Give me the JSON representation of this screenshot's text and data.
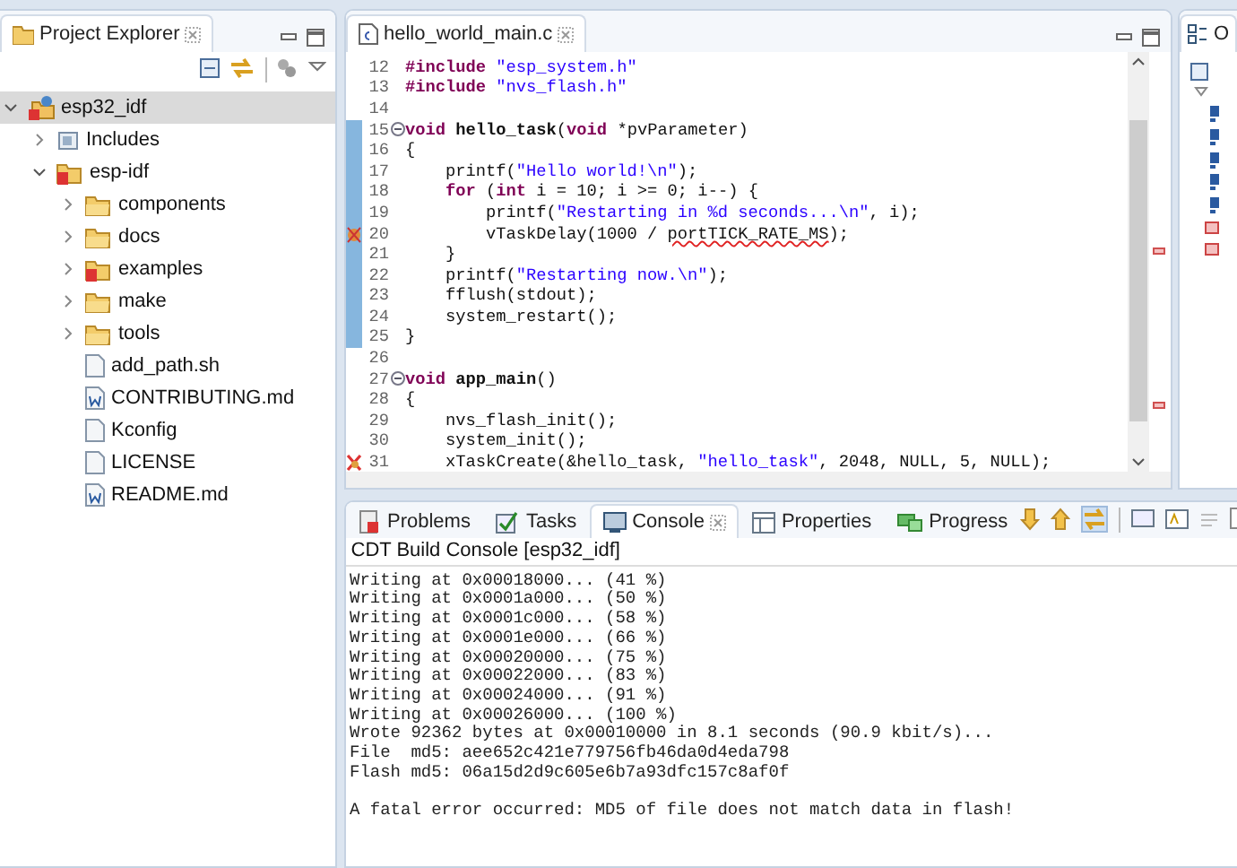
{
  "project_explorer": {
    "title": "Project Explorer",
    "tree": [
      {
        "label": "esp32_idf",
        "kind": "project",
        "expanded": true,
        "selected": true,
        "children": [
          {
            "label": "Includes",
            "kind": "includes",
            "expanded": false,
            "selected": false
          },
          {
            "label": "esp-idf",
            "kind": "folder-error",
            "expanded": true,
            "selected": false,
            "children": [
              {
                "label": "components",
                "kind": "folder",
                "expanded": false,
                "selected": false
              },
              {
                "label": "docs",
                "kind": "folder",
                "expanded": false,
                "selected": false
              },
              {
                "label": "examples",
                "kind": "folder-error",
                "expanded": false,
                "selected": false
              },
              {
                "label": "make",
                "kind": "folder",
                "expanded": false,
                "selected": false
              },
              {
                "label": "tools",
                "kind": "folder",
                "expanded": false,
                "selected": false
              },
              {
                "label": "add_path.sh",
                "kind": "file",
                "selected": false
              },
              {
                "label": "CONTRIBUTING.md",
                "kind": "doc",
                "selected": false
              },
              {
                "label": "Kconfig",
                "kind": "file",
                "selected": false
              },
              {
                "label": "LICENSE",
                "kind": "file",
                "selected": false
              },
              {
                "label": "README.md",
                "kind": "doc",
                "selected": false
              }
            ]
          }
        ]
      }
    ]
  },
  "editor": {
    "tab": "hello_world_main.c",
    "lines": [
      {
        "number": "12",
        "tokens": [
          {
            "kind": "kw",
            "text": "#include"
          },
          {
            "kind": "str",
            "text": " \"esp_system.h\""
          }
        ]
      },
      {
        "number": "13",
        "tokens": [
          {
            "kind": "kw",
            "text": "#include"
          },
          {
            "kind": "str",
            "text": " \"nvs_flash.h\""
          }
        ]
      },
      {
        "number": "14"
      },
      {
        "number": "15",
        "fold": true,
        "changed": true,
        "tokens": [
          {
            "kind": "kw",
            "text": "void"
          },
          {
            "kind": "fn",
            "text": " hello_task"
          },
          {
            "kind": "plain",
            "text": "("
          },
          {
            "kind": "kw",
            "text": "void"
          },
          {
            "kind": "plain",
            "text": " *pvParameter)"
          }
        ]
      },
      {
        "number": "16",
        "changed": true,
        "tokens": [
          {
            "kind": "plain",
            "text": "{"
          }
        ]
      },
      {
        "number": "17",
        "changed": true,
        "tokens": [
          {
            "kind": "plain",
            "text": "    printf("
          },
          {
            "kind": "str",
            "text": "\"Hello world!\\n\""
          },
          {
            "kind": "plain",
            "text": ");"
          }
        ]
      },
      {
        "number": "18",
        "changed": true,
        "tokens": [
          {
            "kind": "kw",
            "text": "    for"
          },
          {
            "kind": "plain",
            "text": " ("
          },
          {
            "kind": "kw",
            "text": "int"
          },
          {
            "kind": "plain",
            "text": " i = 10; i >= 0; i--) {"
          }
        ]
      },
      {
        "number": "19",
        "changed": true,
        "tokens": [
          {
            "kind": "plain",
            "text": "        printf("
          },
          {
            "kind": "str",
            "text": "\"Restarting in %d seconds...\\n\""
          },
          {
            "kind": "plain",
            "text": ", i);"
          }
        ]
      },
      {
        "number": "20",
        "changed": true,
        "warning": true,
        "tokens": [
          {
            "kind": "plain",
            "text": "        vTaskDelay(1000 / "
          },
          {
            "kind": "err",
            "text": "portTICK_RATE_MS"
          },
          {
            "kind": "plain",
            "text": ");"
          }
        ]
      },
      {
        "number": "21",
        "changed": true,
        "tokens": [
          {
            "kind": "plain",
            "text": "    }"
          }
        ]
      },
      {
        "number": "22",
        "changed": true,
        "tokens": [
          {
            "kind": "plain",
            "text": "    printf("
          },
          {
            "kind": "str",
            "text": "\"Restarting now.\\n\""
          },
          {
            "kind": "plain",
            "text": ");"
          }
        ]
      },
      {
        "number": "23",
        "changed": true,
        "tokens": [
          {
            "kind": "plain",
            "text": "    fflush(stdout);"
          }
        ]
      },
      {
        "number": "24",
        "changed": true,
        "tokens": [
          {
            "kind": "plain",
            "text": "    system_restart();"
          }
        ]
      },
      {
        "number": "25",
        "changed": true,
        "tokens": [
          {
            "kind": "plain",
            "text": "}"
          }
        ]
      },
      {
        "number": "26"
      },
      {
        "number": "27",
        "fold": true,
        "tokens": [
          {
            "kind": "kw",
            "text": "void"
          },
          {
            "kind": "fn",
            "text": " app_main"
          },
          {
            "kind": "plain",
            "text": "()"
          }
        ]
      },
      {
        "number": "28",
        "tokens": [
          {
            "kind": "plain",
            "text": "{"
          }
        ]
      },
      {
        "number": "29",
        "tokens": [
          {
            "kind": "plain",
            "text": "    nvs_flash_init();"
          }
        ]
      },
      {
        "number": "30",
        "tokens": [
          {
            "kind": "plain",
            "text": "    system_init();"
          }
        ]
      },
      {
        "number": "31",
        "error": true,
        "tokens": [
          {
            "kind": "plain",
            "text": "    xTaskCreate(&hello_task, "
          },
          {
            "kind": "str",
            "text": "\"hello_task\""
          },
          {
            "kind": "plain",
            "text": ", 2048, NULL, 5, NULL);"
          }
        ]
      }
    ]
  },
  "outline": {
    "title": "O"
  },
  "bottom_panel": {
    "tabs": [
      {
        "label": "Problems",
        "kind": "problems",
        "selected": false
      },
      {
        "label": "Tasks",
        "kind": "tasks",
        "selected": false
      },
      {
        "label": "Console",
        "kind": "console",
        "selected": true
      },
      {
        "label": "Properties",
        "kind": "properties",
        "selected": false
      },
      {
        "label": "Progress",
        "kind": "progress",
        "selected": false
      }
    ],
    "console_title": "CDT Build Console [esp32_idf]",
    "lines": [
      "Writing at 0x00018000... (41 %)",
      "Writing at 0x0001a000... (50 %)",
      "Writing at 0x0001c000... (58 %)",
      "Writing at 0x0001e000... (66 %)",
      "Writing at 0x00020000... (75 %)",
      "Writing at 0x00022000... (83 %)",
      "Writing at 0x00024000... (91 %)",
      "Writing at 0x00026000... (100 %)",
      "Wrote 92362 bytes at 0x00010000 in 8.1 seconds (90.9 kbit/s)...",
      "File  md5: aee652c421e779756fb46da0d4eda798",
      "Flash md5: 06a15d2d9c605e6b7a93dfc157c8af0f"
    ],
    "error_message": "A fatal error occurred: MD5 of file does not match data in flash!"
  }
}
